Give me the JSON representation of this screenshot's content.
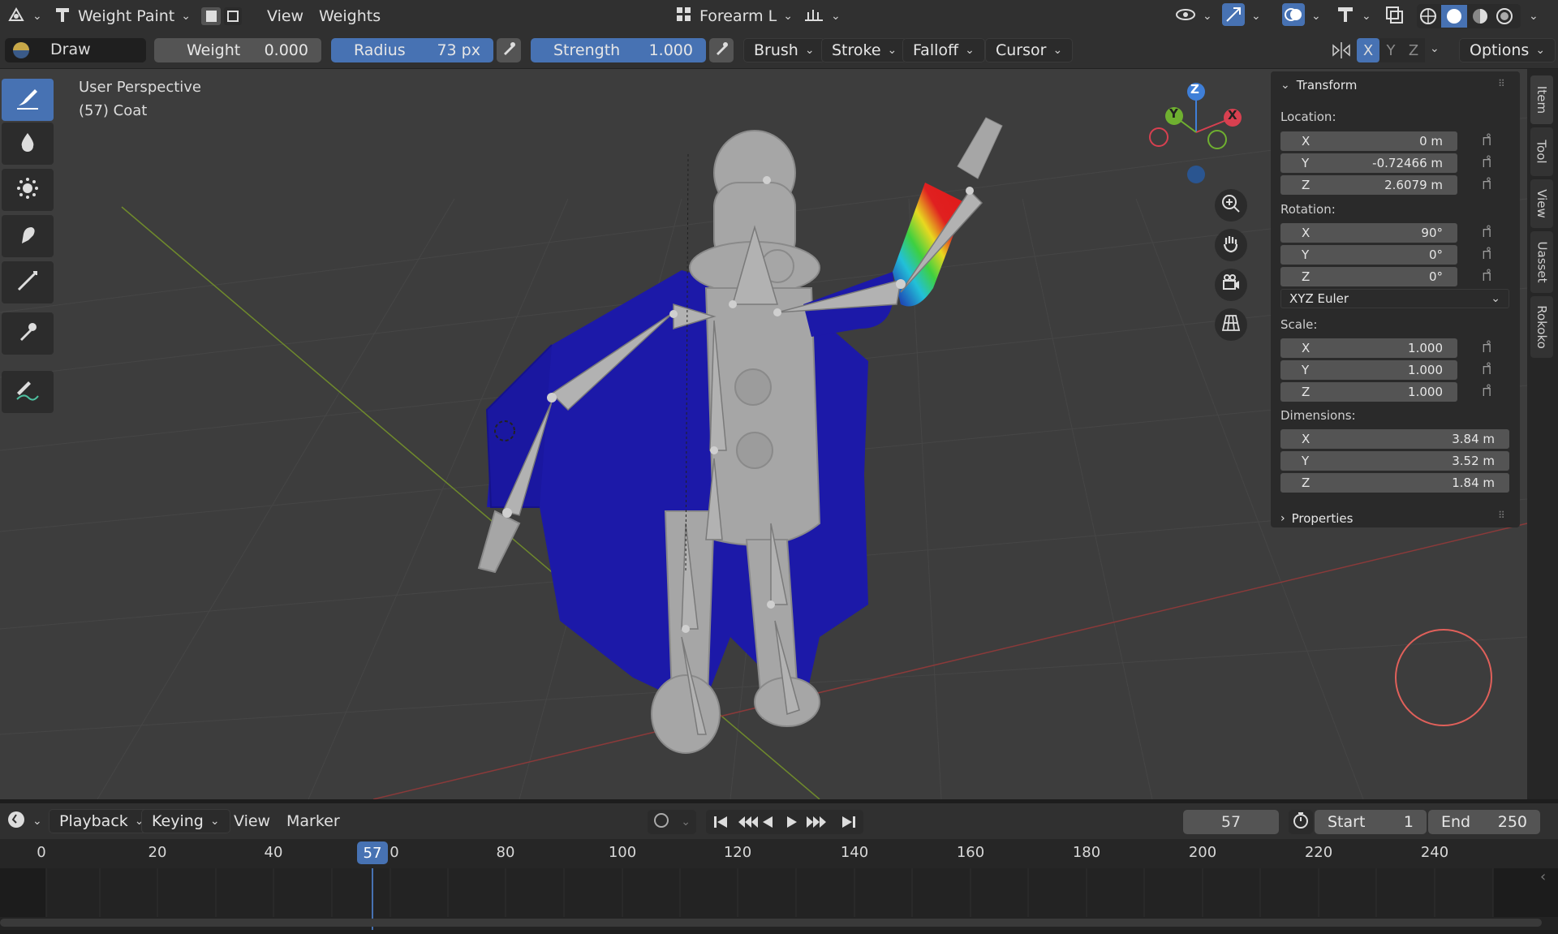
{
  "header": {
    "mode": "Weight Paint",
    "menus": [
      "View",
      "Weights"
    ],
    "bone_group": "Forearm L"
  },
  "tool_settings": {
    "brush_name": "Draw",
    "weight_label": "Weight",
    "weight_value": "0.000",
    "radius_label": "Radius",
    "radius_value": "73 px",
    "strength_label": "Strength",
    "strength_value": "1.000",
    "menus": [
      "Brush",
      "Stroke",
      "Falloff",
      "Cursor"
    ],
    "axes": [
      "X",
      "Y",
      "Z"
    ],
    "options": "Options"
  },
  "viewport": {
    "perspective": "User Perspective",
    "object": "(57) Coat",
    "gizmo": {
      "x": "X",
      "y": "Y",
      "z": "Z"
    }
  },
  "toolbar": [
    "draw-brush",
    "blur-brush",
    "average-brush",
    "smear-brush",
    "gradient-tool",
    "sample-weight-tool",
    "annotate-tool"
  ],
  "npanel": {
    "transform_title": "Transform",
    "location_label": "Location:",
    "location": [
      {
        "axis": "X",
        "value": "0 m"
      },
      {
        "axis": "Y",
        "value": "-0.72466 m"
      },
      {
        "axis": "Z",
        "value": "2.6079 m"
      }
    ],
    "rotation_label": "Rotation:",
    "rotation": [
      {
        "axis": "X",
        "value": "90°"
      },
      {
        "axis": "Y",
        "value": "0°"
      },
      {
        "axis": "Z",
        "value": "0°"
      }
    ],
    "rotation_mode": "XYZ Euler",
    "scale_label": "Scale:",
    "scale": [
      {
        "axis": "X",
        "value": "1.000"
      },
      {
        "axis": "Y",
        "value": "1.000"
      },
      {
        "axis": "Z",
        "value": "1.000"
      }
    ],
    "dimensions_label": "Dimensions:",
    "dimensions": [
      {
        "axis": "X",
        "value": "3.84 m"
      },
      {
        "axis": "Y",
        "value": "3.52 m"
      },
      {
        "axis": "Z",
        "value": "1.84 m"
      }
    ],
    "properties_title": "Properties"
  },
  "side_tabs": [
    "Item",
    "Tool",
    "View",
    "Uasset",
    "Rokoko"
  ],
  "timeline": {
    "menus": [
      "Playback",
      "Keying",
      "View",
      "Marker"
    ],
    "current_frame": "57",
    "start_label": "Start",
    "start_value": "1",
    "end_label": "End",
    "end_value": "250",
    "ruler": [
      "0",
      "20",
      "40",
      "0",
      "80",
      "100",
      "120",
      "140",
      "160",
      "180",
      "200",
      "220",
      "240"
    ],
    "playhead": "57"
  },
  "colors": {
    "accent": "#4772b3",
    "coat": "#1c19a8",
    "body": "#a8a8a8",
    "viewport_bg": "#3d3d3d"
  }
}
